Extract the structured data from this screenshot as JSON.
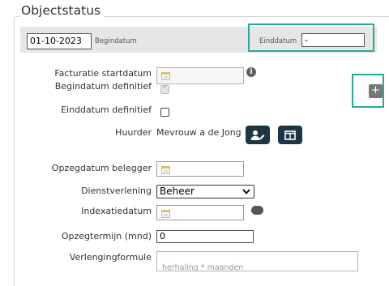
{
  "section": {
    "title": "Objectstatus"
  },
  "dates": {
    "begin_value": "01-10-2023",
    "begin_label": "Begindatum",
    "end_label": "Einddatum",
    "end_value": "-"
  },
  "form": {
    "facturatie_label": "Facturatie startdatum",
    "begindatum_def_label": "Begindatum definitief",
    "begindatum_def_checked": true,
    "einddatum_def_label": "Einddatum definitief",
    "einddatum_def_checked": false,
    "huurder_label": "Huurder",
    "huurder_value": "Mevrouw a de Jong",
    "opzeg_belegger_label": "Opzegdatum belegger",
    "dienst_label": "Dienstverlening",
    "dienst_value": "Beheer",
    "indexatie_label": "Indexatiedatum",
    "opzegtermijn_label": "Opzegtermijn (mnd)",
    "opzegtermijn_value": "0",
    "verlenging_label": "Verlengingformule",
    "verlenging_placeholder": "herhaling * maanden"
  },
  "icons": {
    "info": "info-icon",
    "add": "plus-icon",
    "edit_user": "user-edit-icon",
    "layout": "window-icon",
    "calendar": "calendar-icon",
    "dropdown": "chevron-down-icon"
  },
  "colors": {
    "highlight": "#24aa9c",
    "dark_button": "#1d3644",
    "date_bar": "#e6e6e6"
  }
}
